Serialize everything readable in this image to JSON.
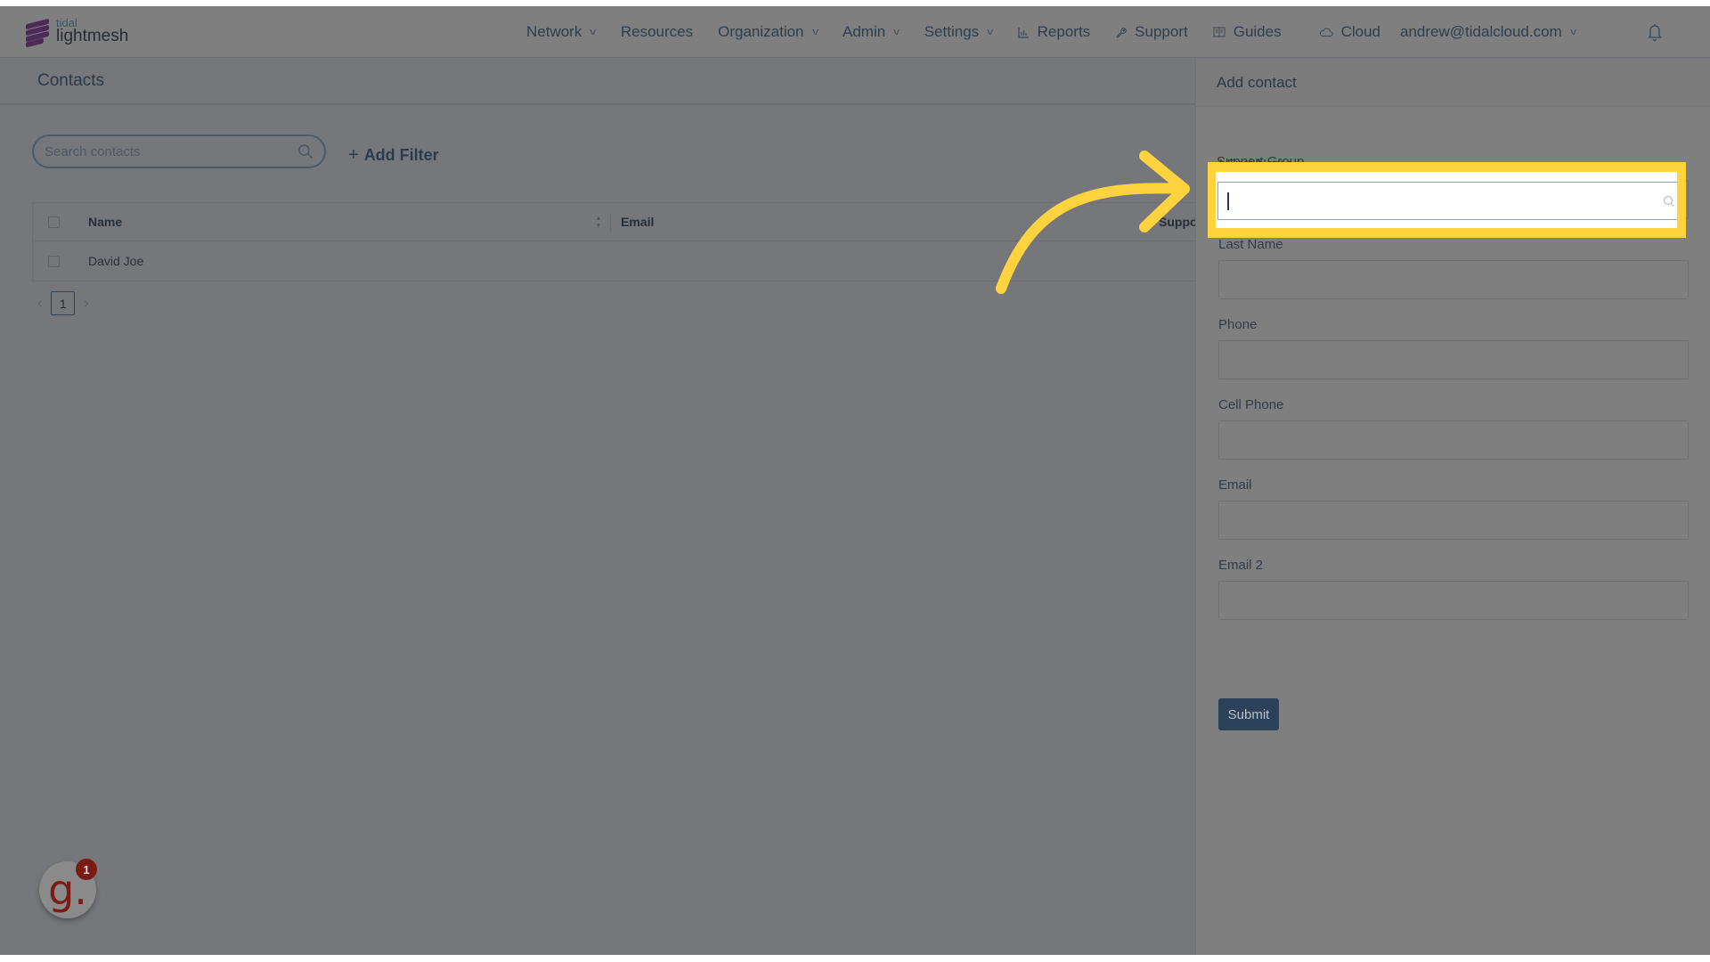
{
  "brand": {
    "small": "tidal",
    "name": "lightmesh"
  },
  "nav": {
    "items": [
      {
        "label": "Network",
        "has_dropdown": true,
        "icon": ""
      },
      {
        "label": "Resources",
        "has_dropdown": false,
        "icon": ""
      },
      {
        "label": "Organization",
        "has_dropdown": true,
        "icon": ""
      },
      {
        "label": "Admin",
        "has_dropdown": true,
        "icon": ""
      },
      {
        "label": "Settings",
        "has_dropdown": true,
        "icon": ""
      },
      {
        "label": "Reports",
        "has_dropdown": false,
        "icon": "chart-icon"
      },
      {
        "label": "Support",
        "has_dropdown": false,
        "icon": "wrench-icon"
      },
      {
        "label": "Guides",
        "has_dropdown": false,
        "icon": "book-icon"
      },
      {
        "label": "Cloud",
        "has_dropdown": false,
        "icon": "cloud-icon"
      }
    ],
    "user": "andrew@tidalcloud.com",
    "chevron": "v",
    "bell_icon": "bell-icon"
  },
  "page": {
    "title": "Contacts",
    "search_placeholder": "Search contacts",
    "add_filter_plus": "+",
    "add_filter_label": "Add Filter",
    "table": {
      "columns": [
        "Name",
        "Email",
        "Suppor"
      ],
      "rows": [
        {
          "name": "David Joe",
          "email": "",
          "support": ""
        }
      ]
    },
    "pagination": {
      "prev": "‹",
      "current": "1",
      "next": "›"
    }
  },
  "panel": {
    "title": "Add contact",
    "highlighted_field": {
      "label": "Support Group",
      "value": ""
    },
    "fields": [
      {
        "label": "First Name",
        "required": true,
        "required_mark": "*",
        "value": ""
      },
      {
        "label": "Last Name",
        "required": false,
        "value": ""
      },
      {
        "label": "Phone",
        "required": false,
        "value": ""
      },
      {
        "label": "Cell Phone",
        "required": false,
        "value": ""
      },
      {
        "label": "Email",
        "required": false,
        "value": ""
      },
      {
        "label": "Email 2",
        "required": false,
        "value": ""
      }
    ],
    "submit_label": "Submit"
  },
  "assistant": {
    "glyph": "g.",
    "badge_count": "1"
  },
  "colors": {
    "highlight": "#ffd33e",
    "primary_button": "#2c425b",
    "brand_purple": "#4e2a5a",
    "required": "#7d2a1f",
    "assistant": "#7a1b14"
  }
}
